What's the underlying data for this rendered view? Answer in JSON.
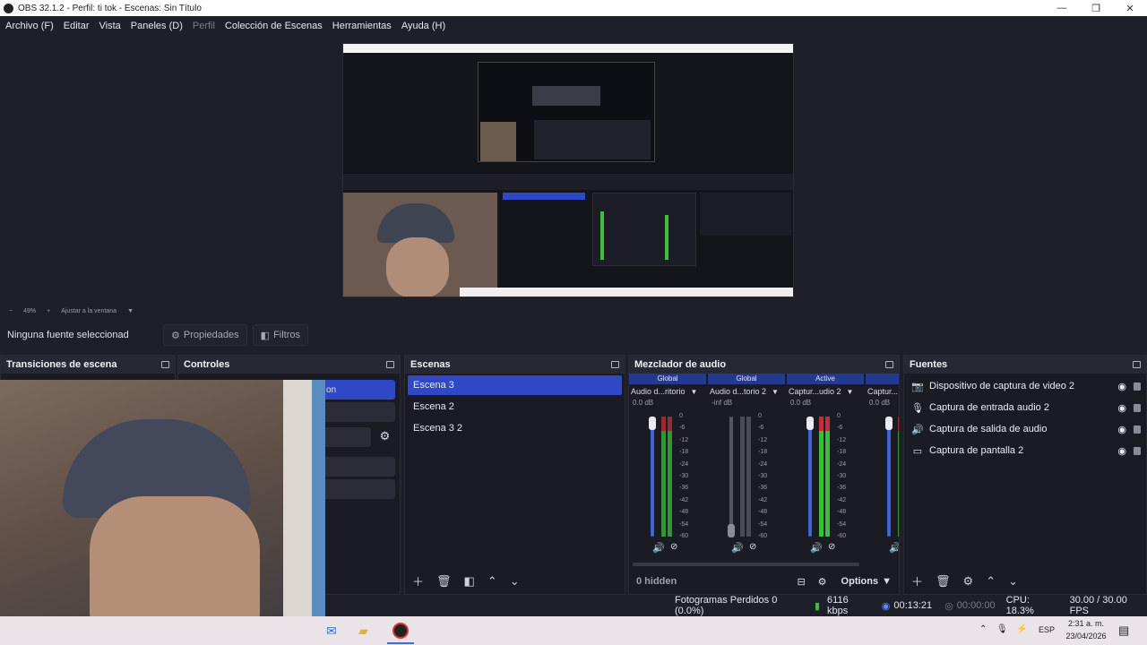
{
  "window": {
    "title": "OBS 32.1.2 - Perfil: ti tok - Escenas: Sin Título",
    "minimize": "—",
    "maximize": "❐",
    "close": "✕"
  },
  "menu": [
    "Archivo (F)",
    "Editar",
    "Vista",
    "Paneles (D)",
    "Perfil",
    "Colección de Escenas",
    "Herramientas",
    "Ayuda (H)"
  ],
  "zoombar": {
    "minus": "−",
    "zoom": "49%",
    "plus": "+",
    "fit": "Ajustar a la ventana"
  },
  "source_bar": {
    "none_selected": "Ninguna fuente seleccionad",
    "properties": "Propiedades",
    "filters": "Filtros"
  },
  "docks": {
    "transitions": {
      "title": "Transiciones de escena"
    },
    "controls": {
      "title": "Controles",
      "partial_text": "on"
    },
    "scenes": {
      "title": "Escenas",
      "items": [
        "Escena 3",
        "Escena 2",
        "Escena 3 2"
      ]
    },
    "mixer": {
      "title": "Mezclador de audio",
      "channels": [
        {
          "tag": "Global",
          "name": "Audio d...ritorio",
          "db": "0.0 dB",
          "muted": false
        },
        {
          "tag": "Global",
          "name": "Audio d...torio 2",
          "db": "-inf dB",
          "muted": true
        },
        {
          "tag": "Active",
          "name": "Captur...udio 2",
          "db": "0.0 dB",
          "muted": false
        },
        {
          "tag": "A",
          "name": "Captur...",
          "db": "0.0 dB",
          "muted": false
        }
      ],
      "scale": [
        "0",
        "-6",
        "-12",
        "-18",
        "-24",
        "-30",
        "-36",
        "-42",
        "-48",
        "-54",
        "-60"
      ],
      "hidden": "0 hidden",
      "options": "Options"
    },
    "sources": {
      "title": "Fuentes",
      "items": [
        {
          "icon": "camera-icon",
          "label": "Dispositivo de captura de video 2"
        },
        {
          "icon": "microphone-icon",
          "label": "Captura de entrada audio 2"
        },
        {
          "icon": "speaker-icon",
          "label": "Captura de salida de audio"
        },
        {
          "icon": "monitor-icon",
          "label": "Captura de pantalla 2"
        }
      ]
    }
  },
  "status": {
    "dropped": "Fotogramas Perdidos 0 (0.0%)",
    "bitrate": "6116 kbps",
    "rec_time": "00:13:21",
    "stream_time": "00:00:00",
    "cpu": "CPU: 18.3%",
    "fps": "30.00 / 30.00 FPS"
  },
  "taskbar": {
    "lang": "ESP",
    "time": "2:31 a. m.",
    "date": "23/04/2026"
  },
  "colors": {
    "accent": "#2f49c6",
    "meter_green": "#3bbf3b",
    "meter_red": "#c0303a",
    "fader": "#3c63d8"
  }
}
